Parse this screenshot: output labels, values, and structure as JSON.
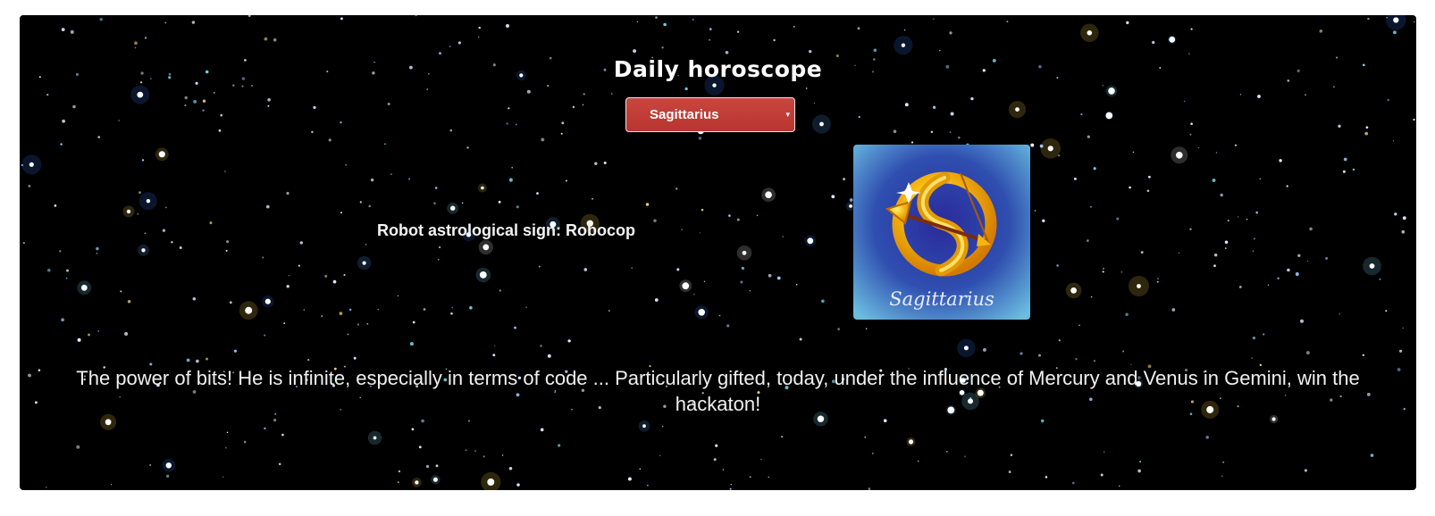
{
  "header": {
    "title": "Daily horoscope"
  },
  "sign_select": {
    "selected": "Sagittarius"
  },
  "robot": {
    "text": "Robot astrological sign: Robocop"
  },
  "sign_image": {
    "caption": "Sagittarius"
  },
  "prediction": {
    "text": "The power of bits! He is infinite, especially in terms of code ... Particularly gifted, today, under the influence of Mercury and Venus in Gemini, win the hackaton!"
  },
  "colors": {
    "panel_background": "#000000",
    "select_background": "#c0392b",
    "card_background": "#2b3fa0",
    "symbol_gold": "#f2b10f"
  }
}
